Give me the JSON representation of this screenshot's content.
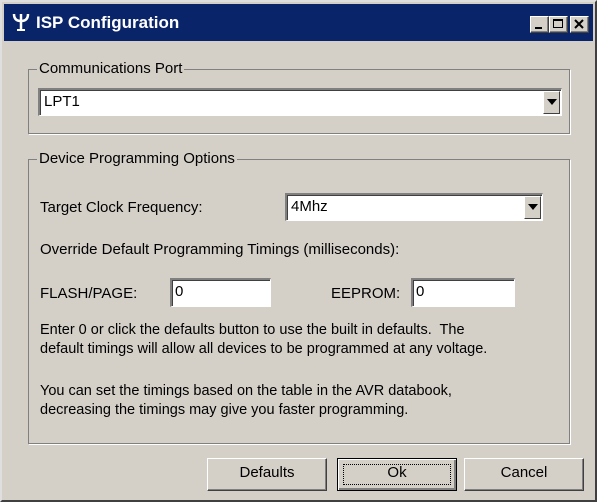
{
  "window": {
    "title": "ISP Configuration"
  },
  "comm_port": {
    "group_label": "Communications Port",
    "selected": "LPT1"
  },
  "device_options": {
    "group_label": "Device Programming Options",
    "clock_label": "Target Clock Frequency:",
    "clock_selected": "4Mhz",
    "override_label": "Override Default Programming Timings (milliseconds):",
    "flash_label": "FLASH/PAGE:",
    "flash_value": "0",
    "eeprom_label": "EEPROM:",
    "eeprom_value": "0",
    "note1_line1": "Enter 0 or click the defaults button to use the built in defaults.  The",
    "note1_line2": "default timings will allow all devices to be programmed at any voltage.",
    "note2_line1": "You can set the timings based on the table in the AVR databook,",
    "note2_line2": "decreasing the timings may give you faster programming."
  },
  "buttons": {
    "defaults": "Defaults",
    "ok": "Ok",
    "cancel": "Cancel"
  },
  "colors": {
    "titlebar": "#0a246a",
    "face": "#d4d0c8"
  },
  "icons": {
    "app": "antenna-icon",
    "minimize": "minimize-icon",
    "maximize": "maximize-icon",
    "close": "close-icon",
    "dropdown": "chevron-down-icon"
  }
}
